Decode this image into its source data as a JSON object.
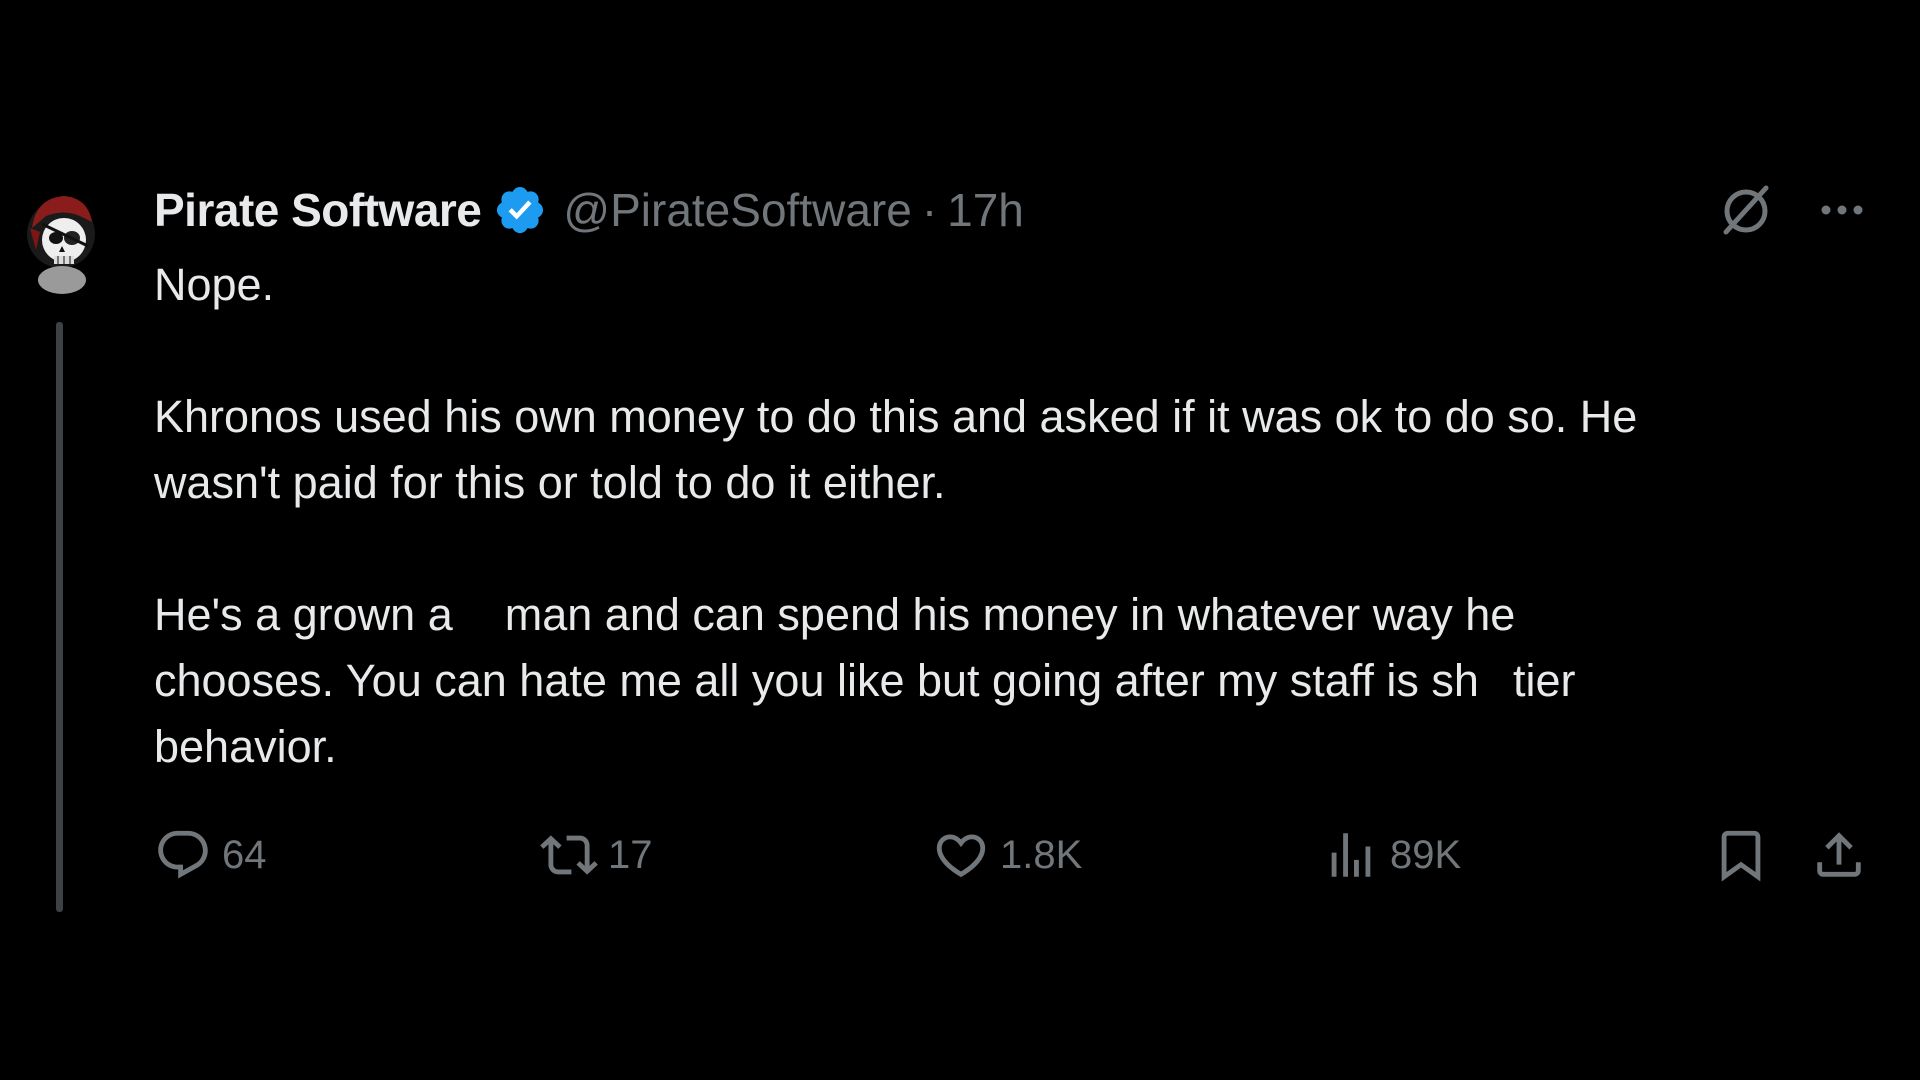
{
  "tweet": {
    "display_name": "Pirate Software",
    "handle": "@PirateSoftware",
    "separator": "·",
    "time": "17h",
    "body": {
      "line1": "Nope.",
      "para2_line1": "Khronos used his own money to do this and asked if it was ok to do so.  He",
      "para2_line2": "wasn't paid for this or told to do it either.",
      "para3_line1_a": "He's a grown a",
      "para3_line1_b": "man and can spend his money in whatever way he",
      "para3_line2_a": "chooses. You can hate me all you like but going after my staff is sh",
      "para3_line2_b": "tier",
      "para3_line3": "behavior."
    },
    "stats": {
      "replies": "64",
      "retweets": "17",
      "likes": "1.8K",
      "views": "89K"
    }
  },
  "icons": {
    "verified": "verified-badge-icon",
    "grok": "grok-icon",
    "more": "more-horizontal-icon",
    "reply": "reply-icon",
    "retweet": "retweet-icon",
    "like": "heart-icon",
    "views": "views-chart-icon",
    "bookmark": "bookmark-icon",
    "share": "share-icon"
  },
  "colors": {
    "background": "#000000",
    "text": "#e7e9ea",
    "secondary": "#71767b",
    "verified": "#1d9bf0",
    "thread_line": "#3e4144"
  }
}
